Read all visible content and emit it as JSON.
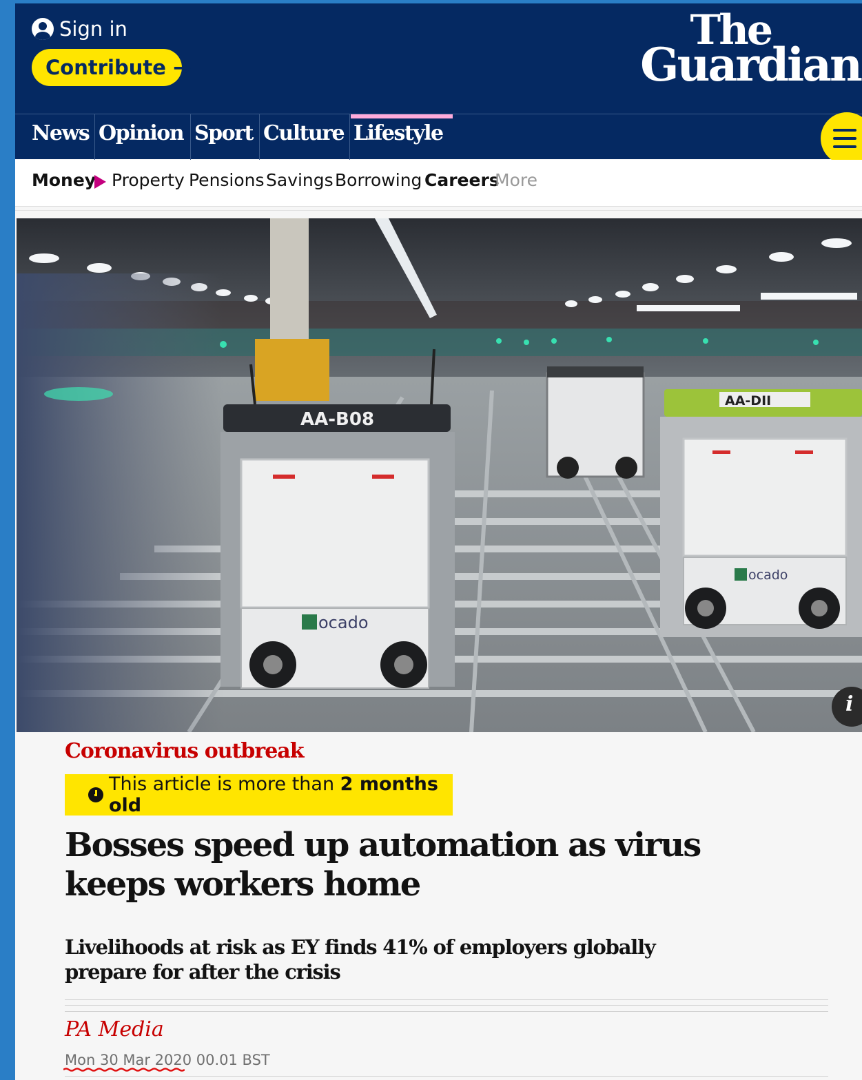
{
  "header": {
    "sign_in": "Sign in",
    "contribute": "Contribute",
    "contribute_arrow": "→",
    "logo_line1": "The",
    "logo_line2": "Guardian"
  },
  "nav": {
    "items": [
      "News",
      "Opinion",
      "Sport",
      "Culture",
      "Lifestyle"
    ],
    "active": "Lifestyle"
  },
  "subnav": {
    "items": [
      "Money",
      "Property",
      "Pensions",
      "Savings",
      "Borrowing",
      "Careers",
      "More"
    ]
  },
  "hero": {
    "robot_left_label": "AA-B08",
    "robot_right_label": "AA-DII",
    "brand": "ocado",
    "info": "i"
  },
  "article": {
    "kicker": "Coronavirus outbreak",
    "age_prefix": "This article is more than ",
    "age_bold": "2 months old",
    "headline": "Bosses speed up automation as virus keeps workers home",
    "standfirst": "Livelihoods at risk as EY finds 41% of employers globally prepare for after the crisis",
    "byline": "PA Media",
    "date": "Mon 30 Mar 2020 00.01 BST"
  },
  "colors": {
    "brand_blue": "#052962",
    "yellow": "#ffe500",
    "news_red": "#c70000",
    "lifestyle_pink": "#ffabdb",
    "outer_bg": "#2a7ec6"
  }
}
